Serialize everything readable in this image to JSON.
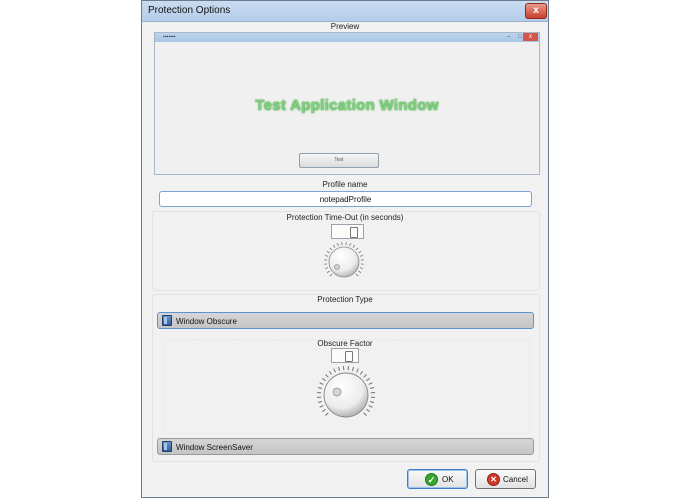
{
  "window": {
    "title": "Protection Options",
    "close_glyph": "x",
    "close_icon": "close-icon"
  },
  "preview": {
    "label": "Preview",
    "app_title": "Test Application Window",
    "app_button_label": "Test",
    "window_controls": "– □",
    "close_glyph": "x"
  },
  "profile": {
    "label": "Profile name",
    "value": "notepadProfile"
  },
  "timeout": {
    "label": "Protection Time-Out (in seconds)",
    "knob_value_fraction": 0.0
  },
  "protection_type": {
    "label": "Protection Type",
    "options": [
      {
        "label": "Window Obscure",
        "expanded": true,
        "icon": "panel-icon"
      },
      {
        "label": "Window ScreenSaver",
        "expanded": false,
        "icon": "panel-icon"
      }
    ],
    "obscure_factor": {
      "label": "Obscure Factor",
      "knob_value_fraction": 0.0
    }
  },
  "buttons": {
    "ok_label": "OK",
    "ok_icon": "check-icon",
    "cancel_label": "Cancel",
    "cancel_icon": "cancel-icon"
  },
  "colors": {
    "accent": "#3c7fc9",
    "ok_green": "#3aa52e",
    "cancel_red": "#d23a2a",
    "preview_text_green": "#6fc46f"
  }
}
